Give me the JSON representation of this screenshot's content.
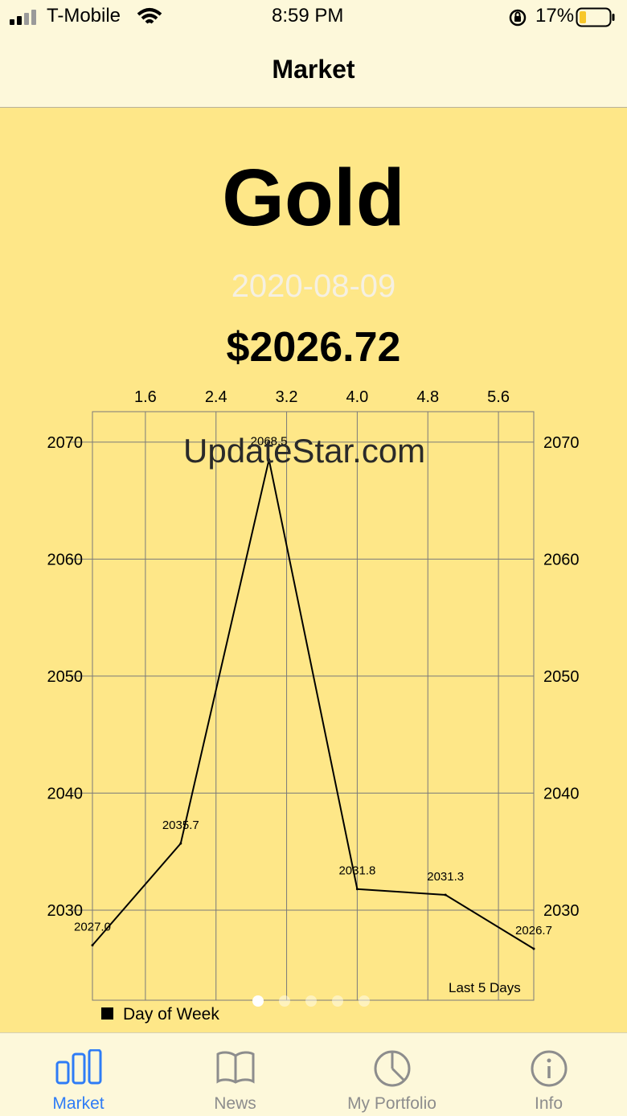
{
  "status": {
    "carrier": "T-Mobile",
    "time": "8:59 PM",
    "battery": "17%"
  },
  "nav": {
    "title": "Market"
  },
  "asset": {
    "name": "Gold",
    "date": "2020-08-09",
    "price": "$2026.72"
  },
  "watermark": "UpdateStar.com",
  "chart_data": {
    "type": "line",
    "x": [
      1,
      2,
      3,
      4,
      5,
      6
    ],
    "values": [
      2027.0,
      2035.7,
      2068.5,
      2031.8,
      2031.3,
      2026.7
    ],
    "data_labels": [
      "2027.0",
      "2035.7",
      "2068.5",
      "2031.8",
      "2031.3",
      "2026.7"
    ],
    "x_ticks": [
      "1.6",
      "2.4",
      "3.2",
      "4.0",
      "4.8",
      "5.6"
    ],
    "x_tick_values": [
      1.6,
      2.4,
      3.2,
      4.0,
      4.8,
      5.6
    ],
    "y_ticks": [
      "2030",
      "2040",
      "2050",
      "2060",
      "2070"
    ],
    "y_tick_values": [
      2030,
      2040,
      2050,
      2060,
      2070
    ],
    "xlim": [
      1,
      6
    ],
    "ylim": [
      2022.3,
      2072.6
    ],
    "grid": true,
    "legend": {
      "label": "Day of Week",
      "position": "bottom-left"
    },
    "description": "Last 5 Days",
    "line_color": "#000000"
  },
  "pager": {
    "count": 5,
    "active": 0
  },
  "tabs": [
    {
      "label": "Market",
      "icon": "bar-chart-icon",
      "active": true
    },
    {
      "label": "News",
      "icon": "book-icon",
      "active": false
    },
    {
      "label": "My Portfolio",
      "icon": "pie-chart-icon",
      "active": false
    },
    {
      "label": "Info",
      "icon": "info-icon",
      "active": false
    }
  ],
  "colors": {
    "background": "#FEE788",
    "bar": "#FDF8DA",
    "accent": "#2E7CF6",
    "inactive": "#8D8D8D"
  }
}
